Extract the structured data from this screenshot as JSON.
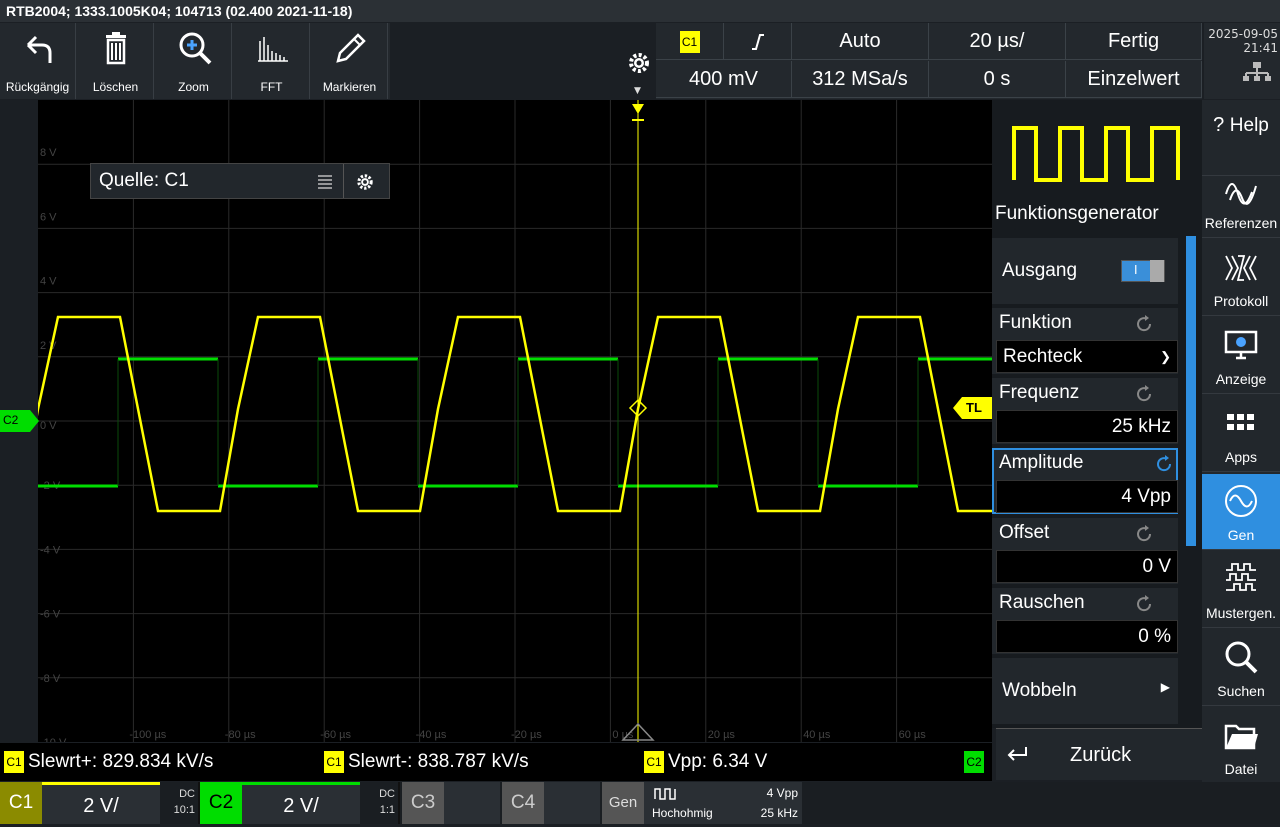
{
  "title": "RTB2004; 1333.1005K04; 104713 (02.400 2021-11-18)",
  "toolbar": [
    {
      "label": "Rückgängig",
      "icon": "undo-icon"
    },
    {
      "label": "Löschen",
      "icon": "trash-icon"
    },
    {
      "label": "Zoom",
      "icon": "zoom-icon"
    },
    {
      "label": "FFT",
      "icon": "fft-icon"
    },
    {
      "label": "Markieren",
      "icon": "pencil-icon"
    }
  ],
  "trigger": {
    "source": "C1",
    "slope": "rising-edge-icon",
    "mode": "Auto",
    "timebase": "20 µs/",
    "status": "Fertig",
    "level": "400 mV",
    "samplerate": "312 MSa/s",
    "offset": "0 s",
    "acq": "Einzelwert"
  },
  "datetime": {
    "date": "2025-09-05",
    "time": "21:41"
  },
  "plot": {
    "ylabels": [
      "8 V",
      "6 V",
      "4 V",
      "2 V",
      "0 V",
      "-2 V",
      "-4 V",
      "-6 V",
      "-8 V",
      "-10 V"
    ],
    "xlabels": [
      "-100 µs",
      "-80 µs",
      "-60 µs",
      "-40 µs",
      "-20 µs",
      "0 µs",
      "20 µs",
      "40 µs",
      "60 µs"
    ],
    "c2_marker": "C2",
    "tl_marker": "TL",
    "colors": {
      "c1": "#ffff00",
      "c2": "#00dd00",
      "grid": "#2a2a2a"
    }
  },
  "quelle": {
    "label": "Quelle: C1"
  },
  "gen": {
    "title": "Funktionsgenerator",
    "ausgang_label": "Ausgang",
    "ausgang_toggle": "I",
    "funktion_label": "Funktion",
    "funktion_value": "Rechteck",
    "frequenz_label": "Frequenz",
    "frequenz_value": "25 kHz",
    "amplitude_label": "Amplitude",
    "amplitude_value": "4 Vpp",
    "offset_label": "Offset",
    "offset_value": "0 V",
    "rauschen_label": "Rauschen",
    "rauschen_value": "0 %",
    "wobbeln_label": "Wobbeln",
    "back_label": "Zurück"
  },
  "sidebar": [
    {
      "label": "Help",
      "icon": "help-icon"
    },
    {
      "label": "Referenzen",
      "icon": "reference-icon"
    },
    {
      "label": "Protokoll",
      "icon": "protocol-icon"
    },
    {
      "label": "Anzeige",
      "icon": "display-icon"
    },
    {
      "label": "Apps",
      "icon": "apps-icon"
    },
    {
      "label": "Gen",
      "icon": "sine-icon"
    },
    {
      "label": "Mustergen.",
      "icon": "pattern-icon"
    },
    {
      "label": "Suchen",
      "icon": "search-icon"
    },
    {
      "label": "Datei",
      "icon": "folder-icon"
    }
  ],
  "measurements": [
    {
      "chip": "C1",
      "text": "Slewrt+: 829.834 kV/s"
    },
    {
      "chip": "C1",
      "text": "Slewrt-: 838.787 kV/s"
    },
    {
      "chip": "C1",
      "text": "Vpp: 6.34 V"
    },
    {
      "chip": "C2",
      "text": ""
    }
  ],
  "channels": [
    {
      "name": "C1",
      "scale": "2 V/",
      "coupling": "DC",
      "probe": "10:1",
      "color": "#ffff00"
    },
    {
      "name": "C2",
      "scale": "2 V/",
      "coupling": "DC",
      "probe": "1:1",
      "color": "#00dd00"
    },
    {
      "name": "C3",
      "scale": "",
      "coupling": "",
      "probe": "",
      "color": "#666666"
    },
    {
      "name": "C4",
      "scale": "",
      "coupling": "",
      "probe": "",
      "color": "#666666"
    }
  ],
  "genbar": {
    "name": "Gen",
    "mode": "Hochohmig",
    "amp": "4 Vpp",
    "freq": "25 kHz"
  }
}
